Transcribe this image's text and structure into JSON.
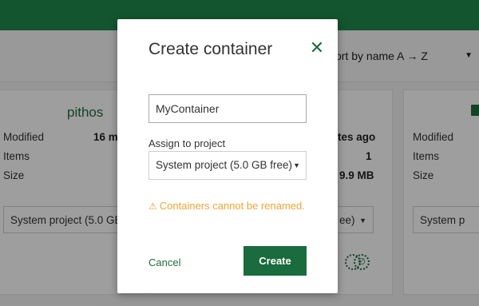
{
  "background": {
    "sort_label": "ort by name A → Z",
    "cards": [
      {
        "title": "pithos",
        "rows": [
          "Modified",
          "Items",
          "Size"
        ],
        "modified_value": "16 m",
        "select": "System project (5.0 GB"
      },
      {
        "values": [
          "tes ago",
          "1",
          "9.9 MB"
        ],
        "select": "ee)"
      },
      {
        "rows": [
          "Modified",
          "Items",
          "Size"
        ],
        "select": "System p"
      }
    ]
  },
  "modal": {
    "title": "Create container",
    "close_glyph": "✕",
    "name_input_value": "MyContainer",
    "assign_label": "Assign to project",
    "project_selected": "System project (5.0 GB free)",
    "warning_icon": "⚠",
    "warning_text": "Containers cannot be renamed.",
    "cancel_label": "Cancel",
    "create_label": "Create"
  },
  "colors": {
    "accent": "#1f8a4b",
    "button": "#1a6b3d",
    "warning": "#f2a530"
  }
}
